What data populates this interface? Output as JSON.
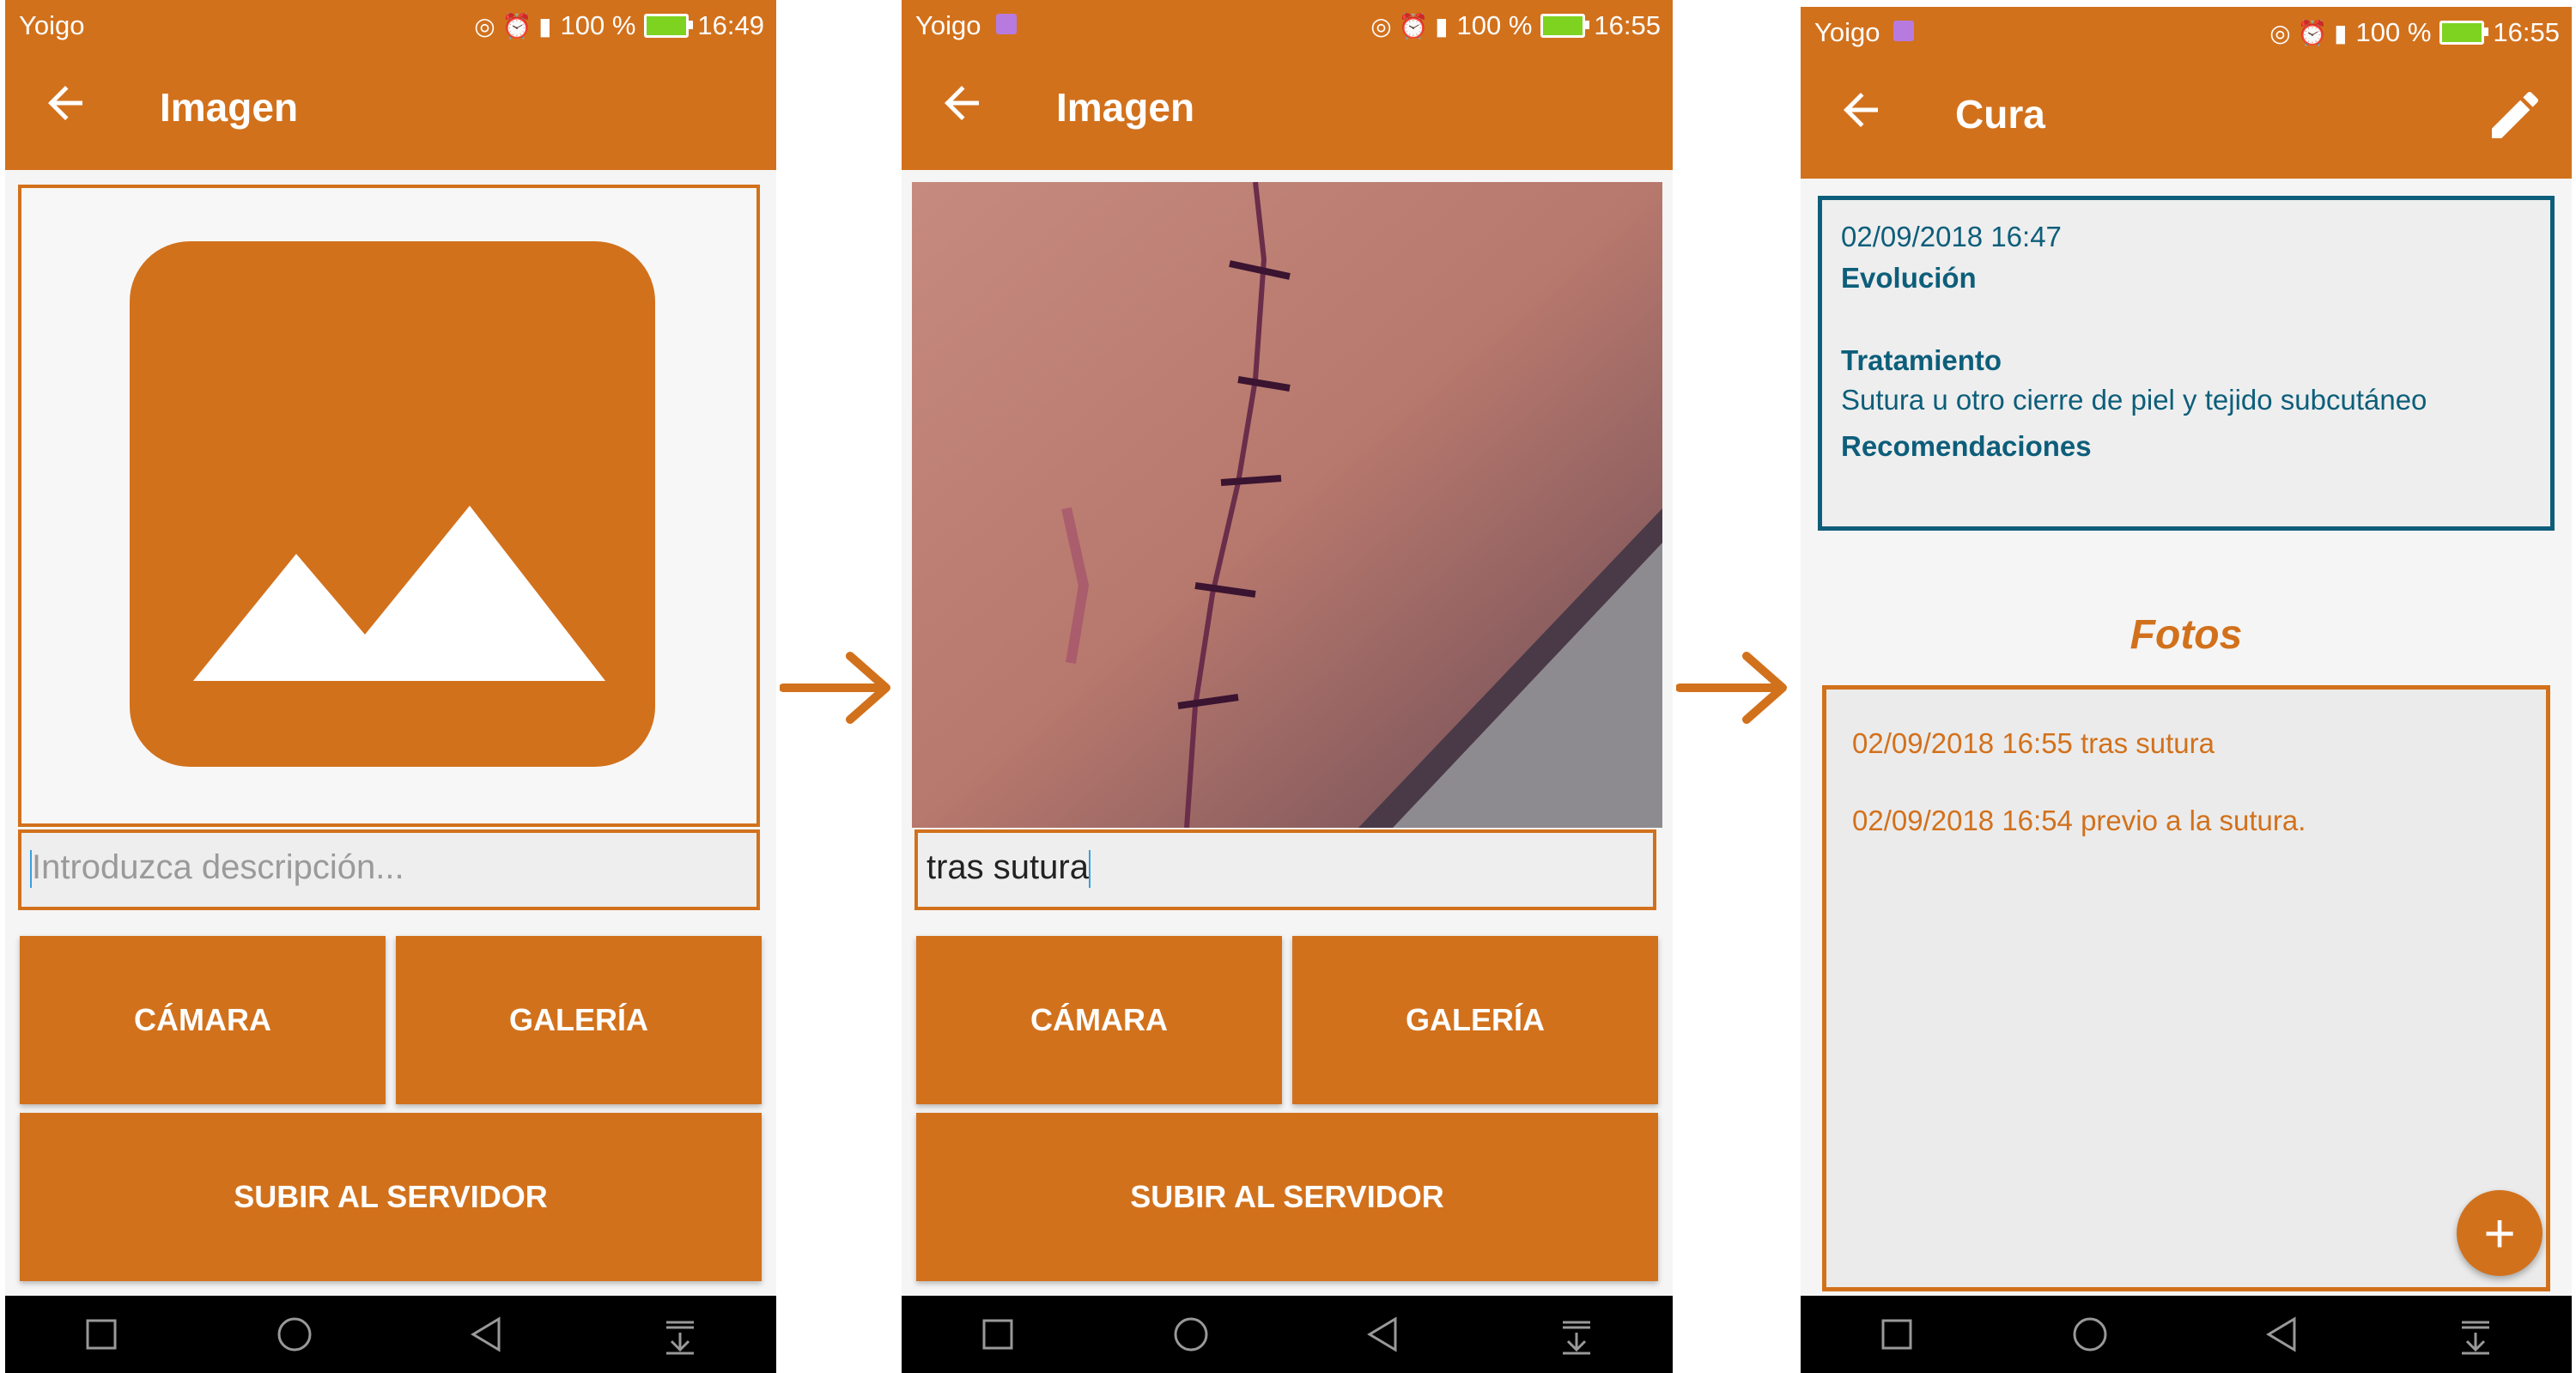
{
  "colors": {
    "primary": "#d2711c",
    "teal": "#0d5e7a",
    "nav": "#000000"
  },
  "status": {
    "carrier": "Yoigo",
    "battery": "100 %",
    "times": [
      "16:49",
      "16:55",
      "16:55"
    ]
  },
  "screen1": {
    "title": "Imagen",
    "description_placeholder": "Introduzca descripción...",
    "camera_label": "CÁMARA",
    "gallery_label": "GALERÍA",
    "upload_label": "SUBIR AL SERVIDOR"
  },
  "screen2": {
    "title": "Imagen",
    "description_value": "tras sutura",
    "camera_label": "CÁMARA",
    "gallery_label": "GALERÍA",
    "upload_label": "SUBIR AL SERVIDOR"
  },
  "screen3": {
    "title": "Cura",
    "card": {
      "date": "02/09/2018 16:47",
      "evolution_label": "Evolución",
      "treatment_label": "Tratamiento",
      "treatment_value": "Sutura u otro cierre de piel y tejido subcutáneo",
      "recommendations_label": "Recomendaciones"
    },
    "photos_title": "Fotos",
    "photos": [
      "02/09/2018 16:55 tras sutura",
      "02/09/2018 16:54 previo a la sutura."
    ],
    "fab_label": "+"
  },
  "icons": [
    "back-arrow-icon",
    "edit-pencil-icon",
    "image-placeholder-icon",
    "flow-arrow-icon",
    "nav-square-icon",
    "nav-circle-icon",
    "nav-triangle-icon",
    "nav-menu-icon",
    "battery-icon"
  ]
}
